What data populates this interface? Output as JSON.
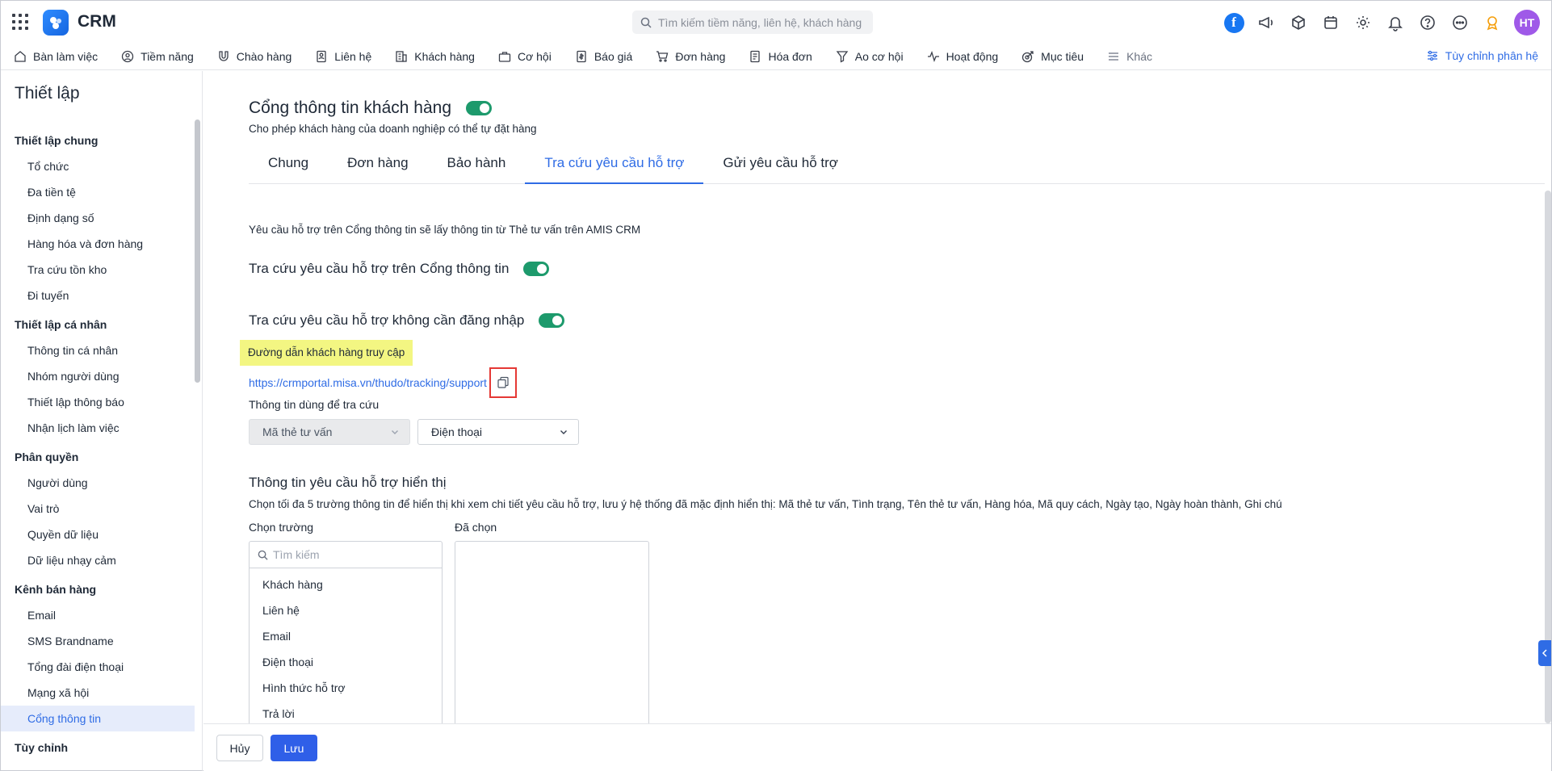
{
  "app": {
    "name": "CRM"
  },
  "search": {
    "placeholder": "Tìm kiếm tiềm năng, liên hệ, khách hàng"
  },
  "user": {
    "initials": "HT"
  },
  "colors": {
    "accent": "#2f6ce5",
    "toggle_on": "#1d9a6c",
    "highlight": "#f3f682",
    "alert_border": "#e53935",
    "avatar": "#9f59e8"
  },
  "nav": {
    "items": [
      {
        "label": "Bàn làm việc",
        "icon": "home-icon"
      },
      {
        "label": "Tiềm năng",
        "icon": "user-circle-icon"
      },
      {
        "label": "Chào hàng",
        "icon": "magnet-icon"
      },
      {
        "label": "Liên hệ",
        "icon": "contact-card-icon"
      },
      {
        "label": "Khách hàng",
        "icon": "building-icon"
      },
      {
        "label": "Cơ hội",
        "icon": "briefcase-icon"
      },
      {
        "label": "Báo giá",
        "icon": "quote-doc-icon"
      },
      {
        "label": "Đơn hàng",
        "icon": "cart-icon"
      },
      {
        "label": "Hóa đơn",
        "icon": "invoice-icon"
      },
      {
        "label": "Ao cơ hội",
        "icon": "funnel-icon"
      },
      {
        "label": "Hoạt động",
        "icon": "pulse-icon"
      },
      {
        "label": "Mục tiêu",
        "icon": "target-icon"
      },
      {
        "label": "Khác",
        "icon": "menu-icon"
      }
    ],
    "customize_label": "Tùy chỉnh phân hệ"
  },
  "sidebar": {
    "title": "Thiết lập",
    "groups": [
      {
        "label": "Thiết lập chung",
        "items": [
          "Tổ chức",
          "Đa tiền tệ",
          "Định dạng số",
          "Hàng hóa và đơn hàng",
          "Tra cứu tồn kho",
          "Đi tuyến"
        ]
      },
      {
        "label": "Thiết lập cá nhân",
        "items": [
          "Thông tin cá nhân",
          "Nhóm người dùng",
          "Thiết lập thông báo",
          "Nhận lịch làm việc"
        ]
      },
      {
        "label": "Phân quyền",
        "items": [
          "Người dùng",
          "Vai trò",
          "Quyền dữ liệu",
          "Dữ liệu nhạy cảm"
        ]
      },
      {
        "label": "Kênh bán hàng",
        "items": [
          "Email",
          "SMS Brandname",
          "Tổng đài điện thoại",
          "Mạng xã hội",
          "Cổng thông tin"
        ]
      },
      {
        "label": "Tùy chỉnh",
        "items": []
      }
    ],
    "active_item": "Cổng thông tin"
  },
  "page": {
    "title": "Cổng thông tin khách hàng",
    "subtitle": "Cho phép khách hàng của doanh nghiệp có thể tự đặt hàng",
    "tabs": [
      "Chung",
      "Đơn hàng",
      "Bảo hành",
      "Tra cứu yêu cầu hỗ trợ",
      "Gửi yêu cầu hỗ trợ"
    ],
    "active_tab": "Tra cứu yêu cầu hỗ trợ",
    "note": "Yêu cầu hỗ trợ trên Cổng thông tin sẽ lấy thông tin từ Thẻ tư vấn trên AMIS CRM",
    "setting_lookup_portal": "Tra cứu yêu cầu hỗ trợ trên Cổng thông tin",
    "setting_lookup_no_login": "Tra cứu yêu cầu hỗ trợ không cần đăng nhập",
    "access_link_label": "Đường dẫn khách hàng truy cập",
    "access_link": "https://crmportal.misa.vn/thudo/tracking/support",
    "lookup_info_label": "Thông tin dùng để tra cứu",
    "lookup_field_1": "Mã thẻ tư vấn",
    "lookup_field_2": "Điện thoại",
    "display_title": "Thông tin yêu cầu hỗ trợ hiển thị",
    "display_desc": "Chọn tối đa 5 trường thông tin để hiển thị khi xem chi tiết yêu cầu hỗ trợ, lưu ý hệ thống đã mặc định hiển thị: Mã thẻ tư vấn, Tình trạng, Tên thẻ tư vấn, Hàng hóa, Mã quy cách, Ngày tạo, Ngày hoàn thành, Ghi chú",
    "choose_field_label": "Chọn trường",
    "chosen_label": "Đã chọn",
    "picker_search_placeholder": "Tìm kiếm",
    "picker_items": [
      "Khách hàng",
      "Liên hệ",
      "Email",
      "Điện thoại",
      "Hình thức hỗ trợ",
      "Trả lời"
    ]
  },
  "footer": {
    "cancel_label": "Hủy",
    "save_label": "Lưu"
  }
}
